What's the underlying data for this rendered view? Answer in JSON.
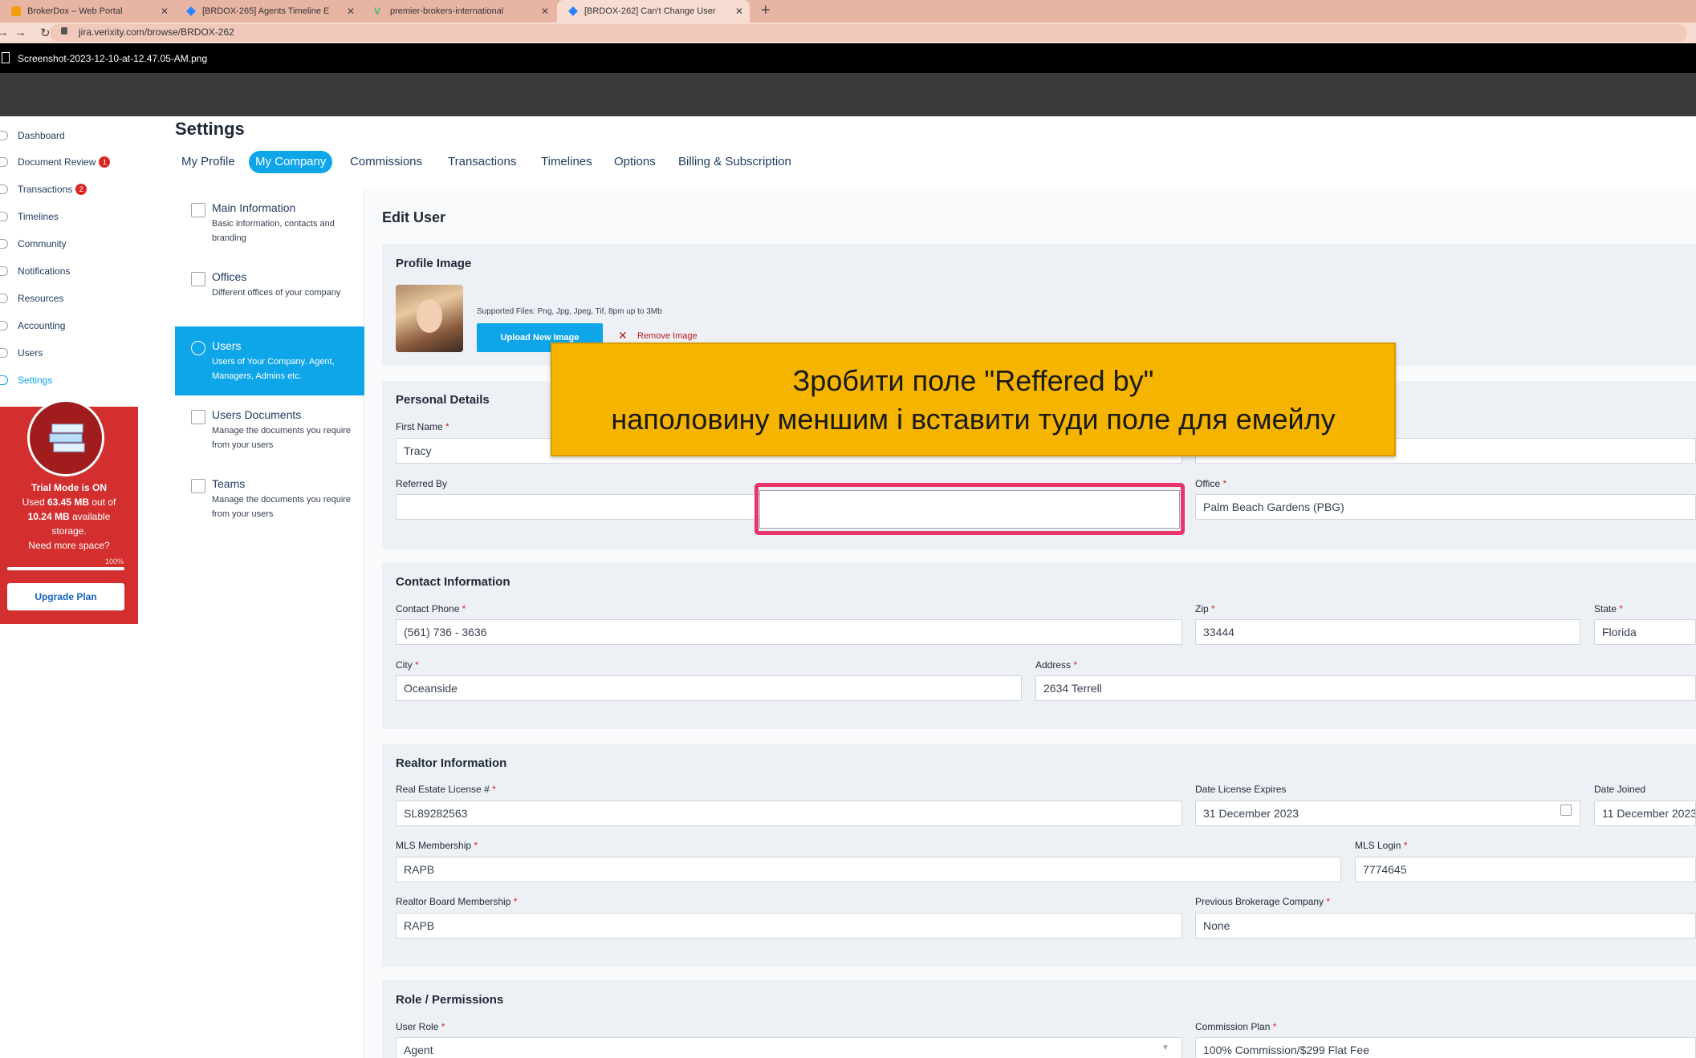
{
  "browser": {
    "tabs": [
      {
        "label": "BrokerDox – Web Portal"
      },
      {
        "label": "[BRDOX-265] Agents Timeline E"
      },
      {
        "label": "premier-brokers-international"
      },
      {
        "label": "[BRDOX-262] Can't Change User"
      }
    ],
    "url": "jira.verixity.com/browse/BRDOX-262",
    "image_filename": "Screenshot-2023-12-10-at-12.47.05-AM.png"
  },
  "sidebar": {
    "items": [
      {
        "label": "Dashboard"
      },
      {
        "label": "Document Review",
        "badge": "1"
      },
      {
        "label": "Transactions",
        "badge": "2"
      },
      {
        "label": "Timelines"
      },
      {
        "label": "Community"
      },
      {
        "label": "Notifications"
      },
      {
        "label": "Resources"
      },
      {
        "label": "Accounting"
      },
      {
        "label": "Users"
      },
      {
        "label": "Settings"
      }
    ],
    "trial": {
      "title": "Trial Mode is ON",
      "used_prefix": "Used",
      "used": "63.45 MB",
      "out_of": "out of",
      "available": "10.24 MB",
      "available_suffix": "available",
      "storage": "storage.",
      "need_more": "Need more space?",
      "percent_label": "100%",
      "percent_value": 100,
      "upgrade": "Upgrade Plan"
    }
  },
  "settings": {
    "title": "Settings",
    "tabs": [
      {
        "label": "My Profile"
      },
      {
        "label": "My Company"
      },
      {
        "label": "Commissions"
      },
      {
        "label": "Transactions"
      },
      {
        "label": "Timelines"
      },
      {
        "label": "Options"
      },
      {
        "label": "Billing & Subscription"
      }
    ],
    "left_tabs": [
      {
        "title": "Main Information",
        "desc": "Basic information, contacts and branding"
      },
      {
        "title": "Offices",
        "desc": "Different offices of your company"
      },
      {
        "title": "Users",
        "desc": "Users of Your Company. Agent, Managers, Admins etc."
      },
      {
        "title": "Users Documents",
        "desc": "Manage the documents you require from your users"
      },
      {
        "title": "Teams",
        "desc": "Manage the documents you require from your users"
      }
    ]
  },
  "form": {
    "title": "Edit User",
    "profile_image": {
      "title": "Profile Image",
      "supported": "Supported Files: Png, Jpg, Jpeg, Tif, 8pm up to 3Mb",
      "upload": "Upload New Image",
      "remove": "Remove Image"
    },
    "personal": {
      "title": "Personal Details",
      "first_name_label": "First Name",
      "first_name": "Tracy",
      "referred_by_label": "Referred By",
      "office_label": "Office",
      "office": "Palm Beach Gardens (PBG)"
    },
    "contact": {
      "title": "Contact Information",
      "phone_label": "Contact Phone",
      "phone": "(561) 736 - 3636",
      "zip_label": "Zip",
      "zip": "33444",
      "state_label": "State",
      "state": "Florida",
      "city_label": "City",
      "city": "Oceanside",
      "address_label": "Address",
      "address": "2634 Terrell"
    },
    "realtor": {
      "title": "Realtor Information",
      "license_label": "Real Estate License #",
      "license": "SL89282563",
      "expires_label": "Date License Expires",
      "expires": "31 December 2023",
      "joined_label": "Date Joined",
      "joined": "11 December 2023",
      "mls_label": "MLS Membership",
      "mls": "RAPB",
      "mls_login_label": "MLS Login",
      "mls_login": "7774645",
      "board_label": "Realtor Board Membership",
      "board": "RAPB",
      "prev_label": "Previous Brokerage Company",
      "prev": "None"
    },
    "role": {
      "title": "Role / Permissions",
      "user_role_label": "User Role",
      "user_role": "Agent",
      "plan_label": "Commission Plan",
      "plan": "100% Commission/$299 Flat Fee"
    }
  },
  "annotation": {
    "line1": "Зробити поле \"Reffered by\"",
    "line2": "наполовину меншим і вставити туди поле для емейлу"
  }
}
